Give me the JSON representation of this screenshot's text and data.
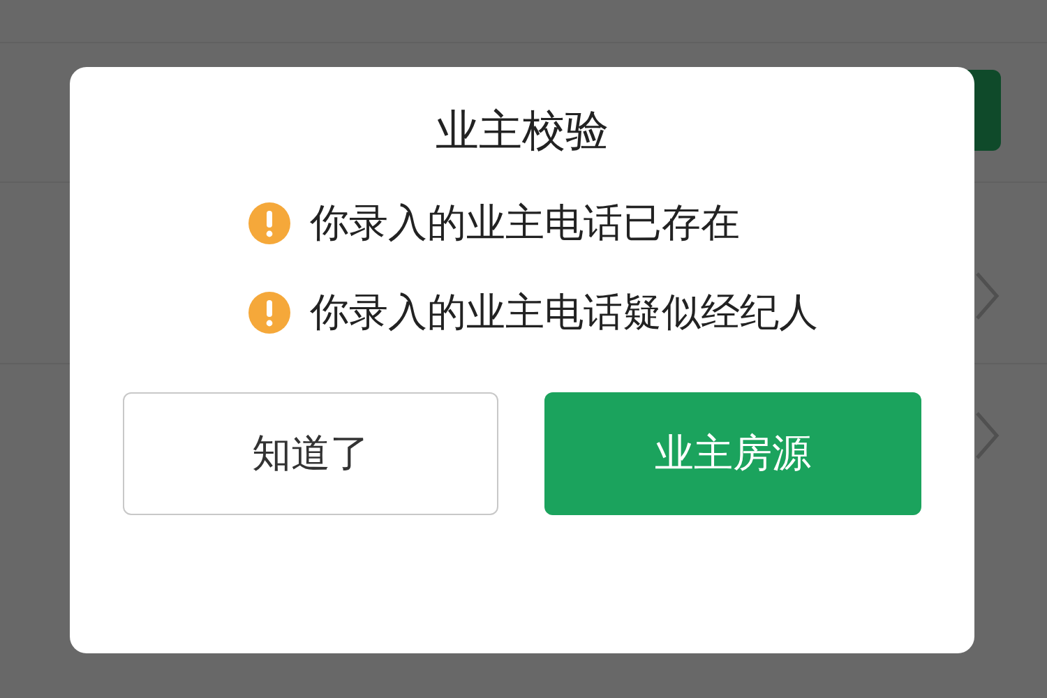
{
  "dialog": {
    "title": "业主校验",
    "warnings": [
      {
        "text": "你录入的业主电话已存在"
      },
      {
        "text": "你录入的业主电话疑似经纪人"
      }
    ],
    "buttons": [
      {
        "label": "知道了",
        "kind": "secondary"
      },
      {
        "label": "业主房源",
        "kind": "primary"
      }
    ]
  }
}
